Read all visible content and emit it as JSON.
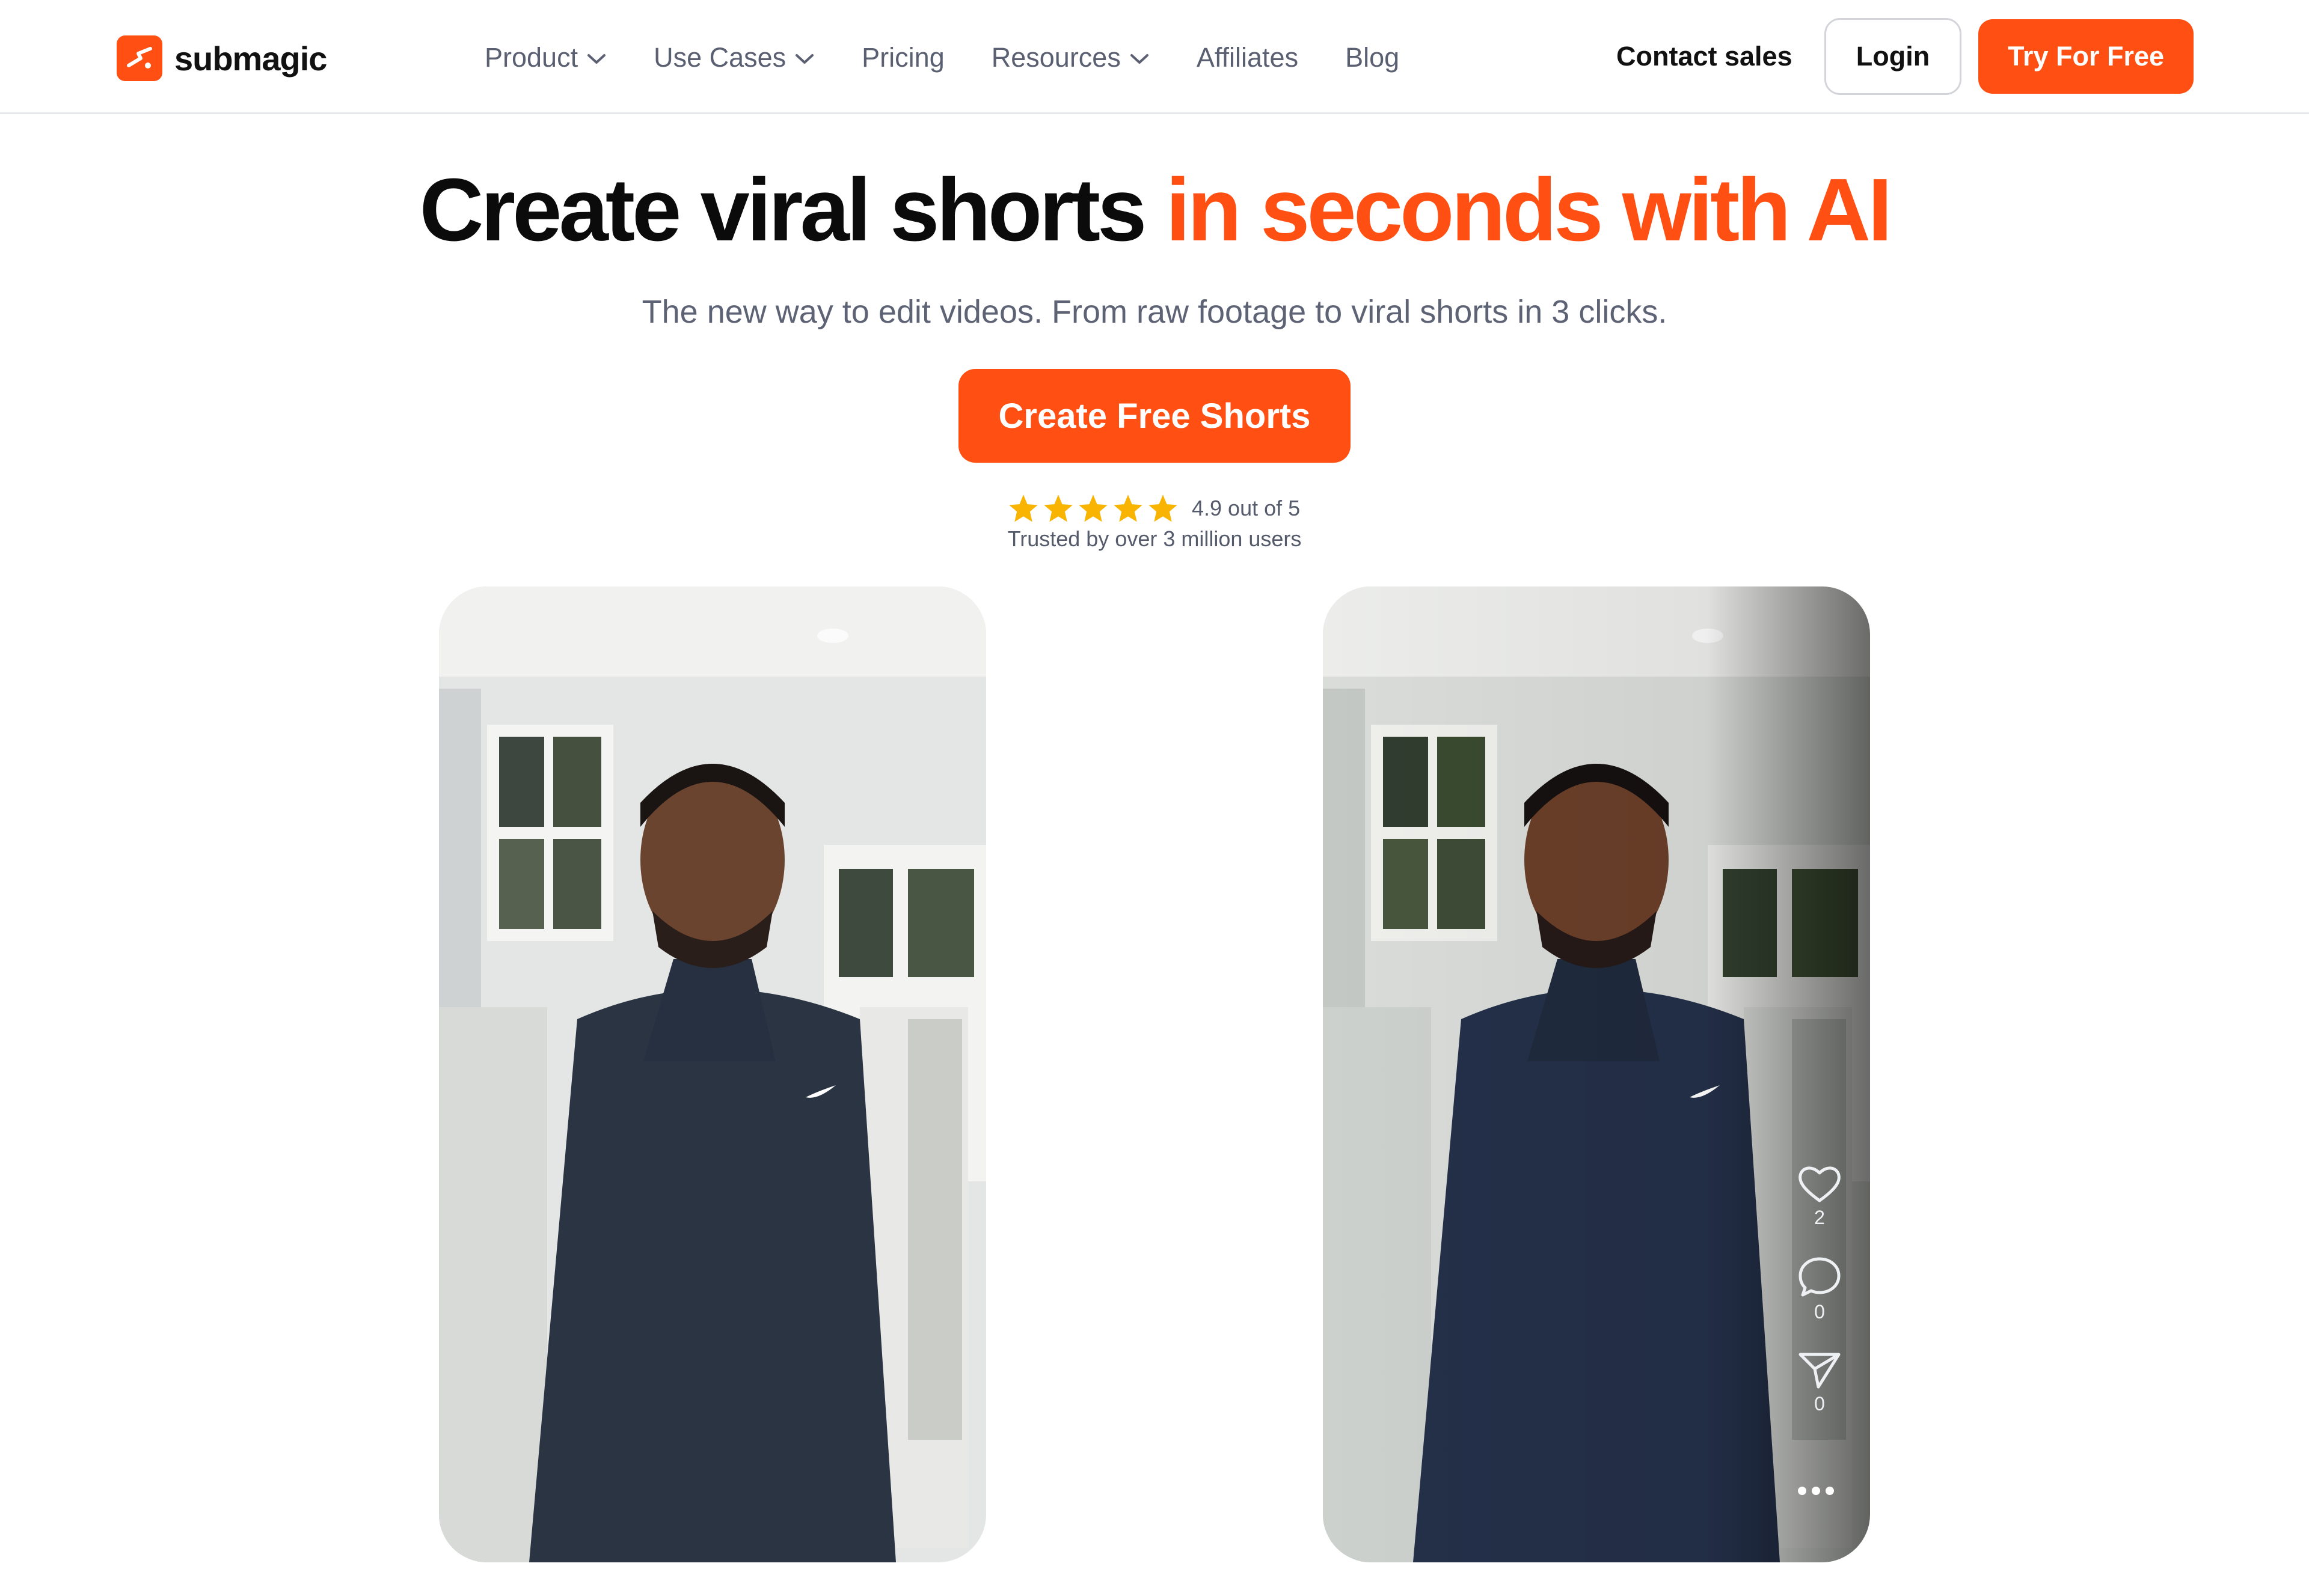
{
  "brand": {
    "name": "submagic",
    "accent": "#ff4f12"
  },
  "nav": {
    "items": [
      {
        "label": "Product",
        "dropdown": true
      },
      {
        "label": "Use Cases",
        "dropdown": true
      },
      {
        "label": "Pricing",
        "dropdown": false
      },
      {
        "label": "Resources",
        "dropdown": true
      },
      {
        "label": "Affiliates",
        "dropdown": false
      },
      {
        "label": "Blog",
        "dropdown": false
      }
    ],
    "contact_label": "Contact sales",
    "login_label": "Login",
    "try_label": "Try For Free"
  },
  "hero": {
    "title_black": "Create viral shorts",
    "title_orange": "in seconds with AI",
    "subtitle": "The new way to edit videos. From raw footage to viral shorts in 3 clicks.",
    "cta_label": "Create Free Shorts",
    "rating_text": "4.9 out of 5",
    "rating_value": 4.9,
    "rating_max": 5,
    "trusted_text": "Trusted by over 3 million users"
  },
  "video_actions": {
    "likes": "2",
    "comments": "0",
    "shares": "0"
  }
}
